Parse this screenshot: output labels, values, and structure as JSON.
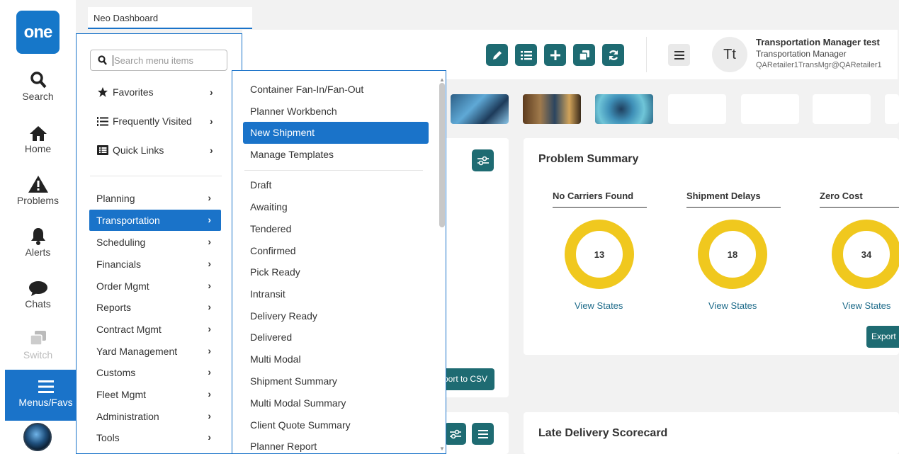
{
  "rail": {
    "logo": "one",
    "items": [
      {
        "label": "Search",
        "icon": "search-icon"
      },
      {
        "label": "Home",
        "icon": "home-icon"
      },
      {
        "label": "Problems",
        "icon": "warning-icon"
      },
      {
        "label": "Alerts",
        "icon": "bell-icon"
      },
      {
        "label": "Chats",
        "icon": "chat-icon"
      },
      {
        "label": "Switch",
        "icon": "switch-icon"
      }
    ],
    "active": {
      "label": "Menus/Favs",
      "icon": "hamburger-icon"
    }
  },
  "tab": {
    "label": "Neo Dashboard"
  },
  "user": {
    "initials": "Tt",
    "name": "Transportation Manager test",
    "role": "Transportation Manager",
    "email": "QARetailer1TransMgr@QARetailer1"
  },
  "menu": {
    "search_placeholder": "Search menu items",
    "favorites": [
      {
        "label": "Favorites",
        "icon": "star-icon"
      },
      {
        "label": "Frequently Visited",
        "icon": "numbered-list-icon"
      },
      {
        "label": "Quick Links",
        "icon": "list-box-icon"
      }
    ],
    "items": [
      "Planning",
      "Transportation",
      "Scheduling",
      "Financials",
      "Order Mgmt",
      "Reports",
      "Contract Mgmt",
      "Yard Management",
      "Customs",
      "Fleet Mgmt",
      "Administration",
      "Tools"
    ],
    "active_index": 1
  },
  "submenu": {
    "top_items": [
      "Container Fan-In/Fan-Out",
      "Planner Workbench",
      "New Shipment",
      "Manage Templates"
    ],
    "active_index": 2,
    "items": [
      "Draft",
      "Awaiting",
      "Tendered",
      "Confirmed",
      "Pick Ready",
      "Intransit",
      "Delivery Ready",
      "Delivered",
      "Multi Modal",
      "Shipment Summary",
      "Multi Modal Summary",
      "Client Quote Summary",
      "Planner Report"
    ]
  },
  "problem_summary": {
    "title": "Problem Summary",
    "metrics": [
      {
        "label": "No Carriers Found",
        "value": "13",
        "link": "View States"
      },
      {
        "label": "Shipment Delays",
        "value": "18",
        "link": "View States"
      },
      {
        "label": "Zero Cost",
        "value": "34",
        "link": "View States"
      }
    ],
    "export_label": "Export"
  },
  "left_card": {
    "csv_label": "port to CSV"
  },
  "late_delivery": {
    "title": "Late Delivery Scorecard"
  },
  "colors": {
    "brand": "#1a73c9",
    "teal": "#1e6b72",
    "donut": "#f0c81e"
  }
}
